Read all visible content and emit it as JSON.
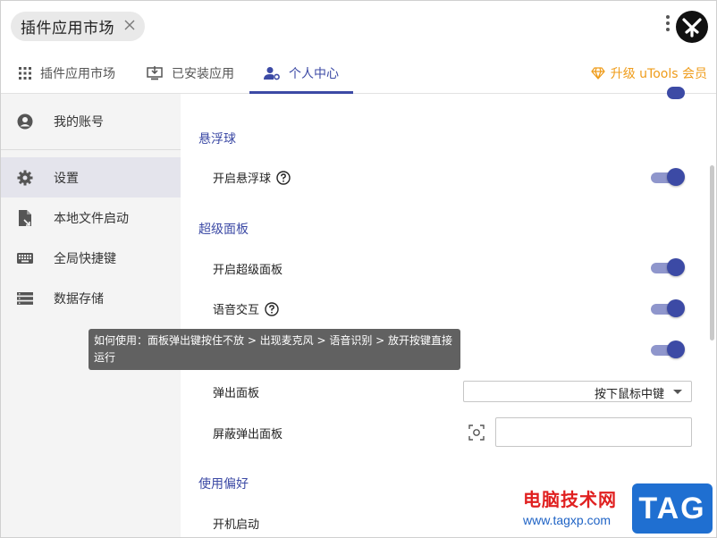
{
  "search": {
    "chip_text": "插件应用市场"
  },
  "tabs": [
    {
      "label": "插件应用市场"
    },
    {
      "label": "已安装应用"
    },
    {
      "label": "个人中心"
    }
  ],
  "upgrade_label": "升级 uTools 会员",
  "sidebar": {
    "items": [
      {
        "label": "我的账号",
        "icon": "user-icon"
      },
      {
        "label": "设置",
        "icon": "gear-icon"
      },
      {
        "label": "本地文件启动",
        "icon": "file-launch-icon"
      },
      {
        "label": "全局快捷键",
        "icon": "keyboard-icon"
      },
      {
        "label": "数据存储",
        "icon": "storage-icon"
      }
    ],
    "active_index": 1
  },
  "settings": {
    "float_ball": {
      "title": "悬浮球",
      "enable_label": "开启悬浮球",
      "enabled": true
    },
    "super_panel": {
      "title": "超级面板",
      "enable_label": "开启超级面板",
      "enabled": true,
      "voice_label": "语音交互",
      "voice_enabled": true,
      "third_enabled": true,
      "popup_label": "弹出面板",
      "popup_value": "按下鼠标中键",
      "block_label": "屏蔽弹出面板"
    },
    "preferences": {
      "title": "使用偏好",
      "autostart_label": "开机启动"
    }
  },
  "tooltip": {
    "line1": "如何使用：面板弹出键按住不放 > 出现麦克风 > 语音识别 > 放开按键直接",
    "line2": "运行"
  },
  "watermark": {
    "text": "电脑技术网",
    "url": "www.tagxp.com",
    "badge": "TAG"
  },
  "colors": {
    "accent": "#3c4aa5",
    "upgrade": "#ef9c1a",
    "sidebar_bg": "#f4f4f4"
  }
}
